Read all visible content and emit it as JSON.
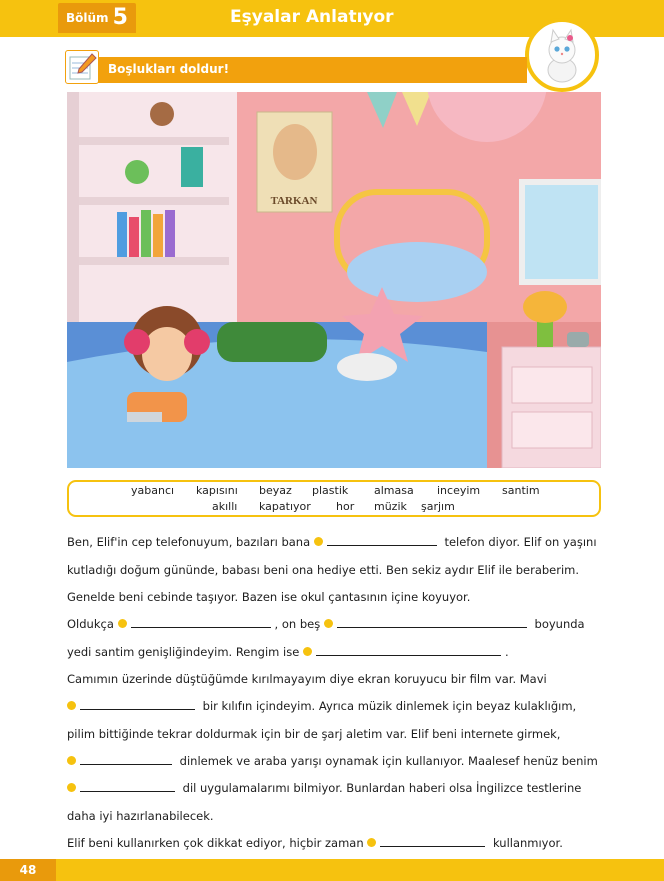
{
  "header": {
    "chapter_word": "Bölüm",
    "chapter_number": "5",
    "title": "Eşyalar Anlatıyor"
  },
  "instruction": {
    "text": "Boşlukları doldur!"
  },
  "illustration": {
    "poster_text": "TARKAN"
  },
  "word_bank": {
    "row1": [
      "yabancı",
      "kapısını",
      "beyaz",
      "plastik",
      "almasa",
      "inceyim",
      "santim"
    ],
    "row2": [
      "akıllı",
      "kapatıyor",
      "hor",
      "müzik",
      "şarjım"
    ]
  },
  "passage": {
    "l1a": "Ben, Elif'in cep telefonuyum, bazıları bana",
    "l1b": "telefon diyor. Elif on yaşını",
    "l2": "kutladığı doğum gününde, babası beni ona hediye etti. Ben sekiz aydır Elif ile beraberim.",
    "l3": "Genelde beni cebinde taşıyor. Bazen ise okul çantasının içine koyuyor.",
    "l4a": "Oldukça",
    "l4b": ", on beş",
    "l4c": "boyunda",
    "l5a": "yedi santim genişliğindeyim. Rengim ise",
    "l5b": ".",
    "l6": "Camımın üzerinde düştüğümde kırılmayayım diye ekran koruyucu bir film var. Mavi",
    "l7": "bir kılıfın içindeyim. Ayrıca müzik dinlemek için beyaz kulaklığım,",
    "l8": "pilim bittiğinde tekrar doldurmak için bir de şarj aletim var. Elif beni internete girmek,",
    "l9": "dinlemek ve araba yarışı oynamak için kullanıyor. Maalesef henüz benim",
    "l10": "dil uygulamalarımı bilmiyor. Bunlardan haberi olsa İngilizce testlerine",
    "l11": "daha iyi hazırlanabilecek.",
    "l12a": "Elif beni kullanırken çok dikkat ediyor, hiçbir zaman",
    "l12b": "kullanmıyor."
  },
  "footer": {
    "page_number": "48"
  },
  "colors": {
    "yellow": "#f6c20f",
    "orange": "#e99a0c"
  }
}
